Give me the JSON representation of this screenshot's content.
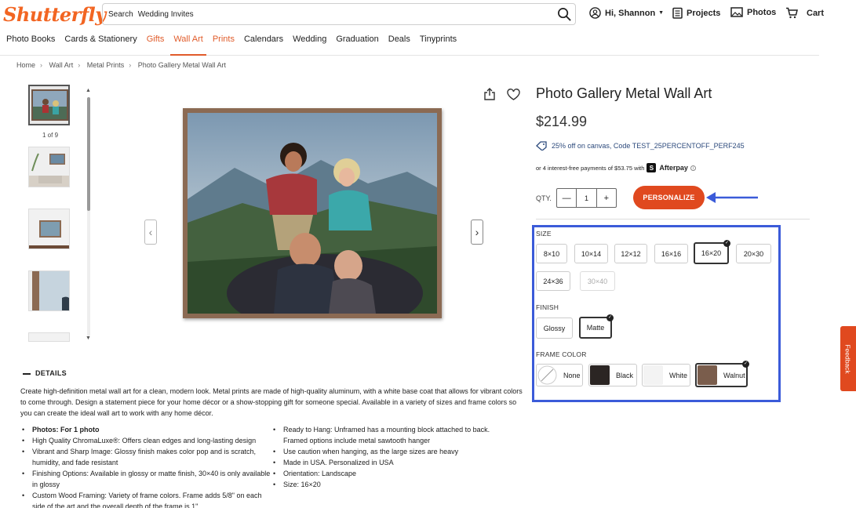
{
  "header": {
    "logo": "Shutterfly",
    "search": {
      "label": "Search",
      "value": "Wedding Invites"
    },
    "account": "Hi, Shannon",
    "projects": "Projects",
    "photos": "Photos",
    "cart": "Cart"
  },
  "nav": [
    "Photo Books",
    "Cards & Stationery",
    "Gifts",
    "Wall Art",
    "Prints",
    "Calendars",
    "Wedding",
    "Graduation",
    "Deals",
    "Tinyprints"
  ],
  "breadcrumb": [
    "Home",
    "Wall Art",
    "Metal Prints",
    "Photo Gallery Metal Wall Art"
  ],
  "gallery": {
    "count": "1 of 9"
  },
  "product": {
    "title": "Photo Gallery Metal Wall Art",
    "price": "$214.99",
    "promo": "25% off on canvas, Code TEST_25PERCENTOFF_PERF245",
    "afterpay_text": "or 4 interest-free payments of $53.75 with",
    "afterpay_brand": "Afterpay",
    "qty_label": "QTY.",
    "qty_value": "1",
    "personalize": "PERSONALIZE"
  },
  "options": {
    "size_label": "SIZE",
    "sizes": [
      "8×10",
      "10×14",
      "12×12",
      "16×16",
      "16×20",
      "20×30",
      "24×36",
      "30×40"
    ],
    "selected_size": "16×20",
    "finish_label": "FINISH",
    "finishes": [
      "Glossy",
      "Matte"
    ],
    "frame_label": "FRAME COLOR",
    "frames": [
      "None",
      "Black",
      "White",
      "Walnut"
    ]
  },
  "details": {
    "title": "DETAILS",
    "description": "Create high-definition metal wall art for a clean, modern look. Metal prints are made of high-quality aluminum, with a white base coat that allows for vibrant colors to come through. Design a statement piece for your home décor or a show-stopping gift for someone special. Available in a variety of sizes and frame colors so you can create the ideal wall art to work with any home décor.",
    "bullets_left": [
      "Photos: For 1 photo",
      "High Quality ChromaLuxe®: Offers clean edges and long-lasting design",
      "Vibrant and Sharp Image: Glossy finish makes color pop and is scratch, humidity, and fade resistant",
      "Finishing Options: Available in glossy or matte finish, 30×40 is only available in glossy",
      "Custom Wood Framing: Variety of frame colors. Frame adds 5/8\" on each side of the art and the overall depth of the frame is 1\""
    ],
    "bullets_right": [
      "Ready to Hang: Unframed has a mounting block attached to back. Framed options include metal sawtooth hanger",
      "Use caution when hanging, as the large sizes are heavy",
      "Made in USA. Personalized in USA",
      "Orientation: Landscape",
      "Size: 16×20"
    ]
  },
  "feedback": "Feedback",
  "colors": {
    "brand": "#f26522",
    "cta": "#e0491f",
    "highlight": "#3b5bd9"
  }
}
